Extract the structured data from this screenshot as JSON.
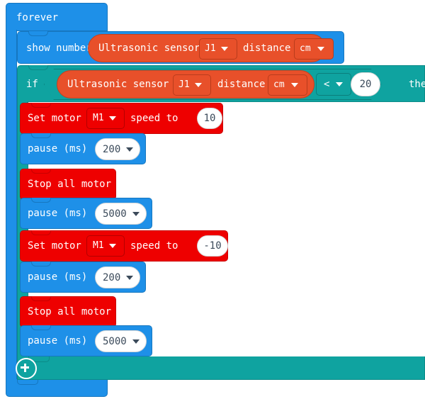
{
  "program": {
    "forever": {
      "label": "forever",
      "color": "#1E90E8"
    },
    "show_number": {
      "label": "show number",
      "color": "#1E90E8",
      "reporter": {
        "name": "Ultrasonic sensor",
        "color": "#E8502A",
        "port": {
          "value": "J1",
          "icon": "chevron-down-icon"
        },
        "unit_label": "distance",
        "unit": {
          "value": "cm",
          "icon": "chevron-down-icon"
        }
      }
    },
    "if_block": {
      "if_label": "if",
      "then_label": "then",
      "color": "#0FA3A0",
      "condition": {
        "reporter": {
          "name": "Ultrasonic sensor",
          "color": "#E8502A",
          "port": {
            "value": "J1",
            "icon": "chevron-down-icon"
          },
          "unit_label": "distance",
          "unit": {
            "value": "cm",
            "icon": "chevron-down-icon"
          }
        },
        "operator": {
          "value": "<",
          "icon": "chevron-down-icon"
        },
        "compare_value": "20"
      },
      "add_button": {
        "icon": "plus-circle-icon"
      },
      "body": [
        {
          "type": "set-motor",
          "color": "#EE0000",
          "prefix": "Set motor",
          "motor": {
            "value": "M1",
            "icon": "chevron-down-icon"
          },
          "mid": "speed to",
          "speed": "10",
          "suffix": "%"
        },
        {
          "type": "pause",
          "color": "#1E90E8",
          "label": "pause (ms)",
          "value": "200",
          "icon": "chevron-down-icon"
        },
        {
          "type": "stop-all-motor",
          "color": "#EE0000",
          "label": "Stop all motor"
        },
        {
          "type": "pause",
          "color": "#1E90E8",
          "label": "pause (ms)",
          "value": "5000",
          "icon": "chevron-down-icon"
        },
        {
          "type": "set-motor",
          "color": "#EE0000",
          "prefix": "Set motor",
          "motor": {
            "value": "M1",
            "icon": "chevron-down-icon"
          },
          "mid": "speed to",
          "speed": "-10",
          "suffix": "%"
        },
        {
          "type": "pause",
          "color": "#1E90E8",
          "label": "pause (ms)",
          "value": "200",
          "icon": "chevron-down-icon"
        },
        {
          "type": "stop-all-motor",
          "color": "#EE0000",
          "label": "Stop all motor"
        },
        {
          "type": "pause",
          "color": "#1E90E8",
          "label": "pause (ms)",
          "value": "5000",
          "icon": "chevron-down-icon"
        }
      ]
    }
  }
}
